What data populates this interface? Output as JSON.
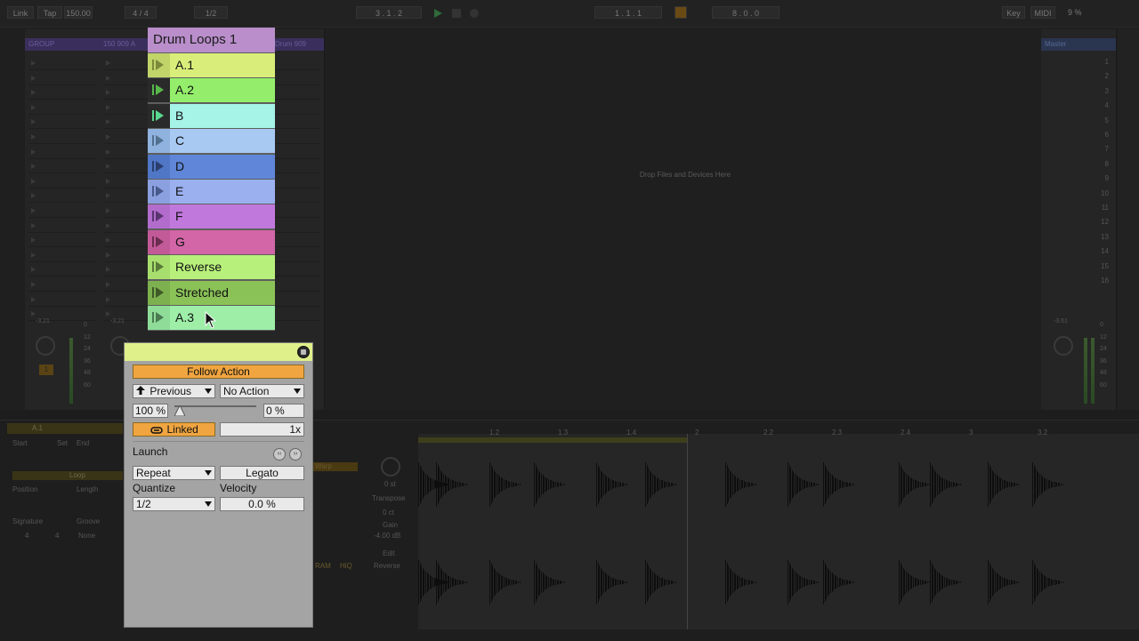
{
  "topbar": {
    "link": "Link",
    "tap": "Tap",
    "tempo": "150.00",
    "signature": "4 / 4",
    "quantize": "1/2",
    "position": "3 . 1 . 2",
    "loop_start": "1 . 1 . 1",
    "loop_length": "8 . 0 . 0",
    "key": "Key",
    "midi": "MIDI",
    "cpu": "9 %"
  },
  "session": {
    "track_names": [
      "GROUP",
      "150 909 A",
      "Drum 909"
    ],
    "drop_text": "Drop Files and Devices Here",
    "master_label": "Master",
    "scene_numbers": [
      "1",
      "2",
      "3",
      "4",
      "5",
      "6",
      "7",
      "8",
      "9",
      "10",
      "11",
      "12",
      "13",
      "14",
      "15",
      "16"
    ],
    "volume_left": "-3.21",
    "volume_mid": "-3.21",
    "volume_master": "-3.61",
    "db_scale": [
      "0",
      "12",
      "24",
      "36",
      "48",
      "60"
    ]
  },
  "clip_list": {
    "title": "Drum Loops 1",
    "clips": [
      {
        "label": "A.1",
        "color": "#d9ee7a",
        "tab": "#c0d46a",
        "icon": "#7a8a3a"
      },
      {
        "label": "A.2",
        "color": "#94ee6b",
        "tab": "#2a2a2a",
        "icon": "#58b84a"
      },
      {
        "label": "B",
        "color": "#a6f3e8",
        "tab": "#2a2a2a",
        "icon": "#5ad890"
      },
      {
        "label": "C",
        "color": "#a7c9f2",
        "tab": "#8fb3de",
        "icon": "#52708f"
      },
      {
        "label": "D",
        "color": "#5f86d8",
        "tab": "#5076c6",
        "icon": "#2a3f6e"
      },
      {
        "label": "E",
        "color": "#9ab0ef",
        "tab": "#8ba0de",
        "icon": "#48598a"
      },
      {
        "label": "F",
        "color": "#c178dd",
        "tab": "#b26ccc",
        "icon": "#5a3470"
      },
      {
        "label": "G",
        "color": "#d266a6",
        "tab": "#c25a98",
        "icon": "#6a2c50"
      },
      {
        "label": "Reverse",
        "color": "#b8f07c",
        "tab": "#a8de6e",
        "icon": "#5a7a38"
      },
      {
        "label": "Stretched",
        "color": "#8bc258",
        "tab": "#7db04e",
        "icon": "#3e5a28"
      },
      {
        "label": "A.3",
        "color": "#9eeea8",
        "tab": "#8edc98",
        "icon": "#4a7a50"
      }
    ]
  },
  "panel": {
    "follow_action": "Follow Action",
    "action_a": "Previous",
    "action_b": "No Action",
    "chance_a": "100 %",
    "chance_b": "0 %",
    "chance_a_fraction": 1.0,
    "linked": "Linked",
    "multiplier": "1x",
    "launch": "Launch",
    "launch_mode": "Repeat",
    "legato": "Legato",
    "quantize_label": "Quantize",
    "velocity_label": "Velocity",
    "quantize_value": "1/2",
    "velocity_value": "0.0 %"
  },
  "detail": {
    "clip_name": "A.1",
    "start": "Start",
    "end": "End",
    "set": "Set",
    "loop": "Loop",
    "position": "Position",
    "length": "Length",
    "signature": "Signature",
    "groove": "Groove",
    "groove_value": "None",
    "sig_num": "4",
    "sig_den": "4",
    "warp": "Warp",
    "transpose": "Transpose",
    "transpose_value": "0 st",
    "detune_value": "0 ct",
    "gain": "Gain",
    "gain_value": "-4.00 dB",
    "edit": "Edit",
    "reverse": "Reverse",
    "ram": "RAM",
    "hiq": "HiQ",
    "ruler": [
      "1.2",
      "1.3",
      "1.4",
      "2",
      "2.2",
      "2.3",
      "2.4",
      "3",
      "3.2"
    ]
  }
}
